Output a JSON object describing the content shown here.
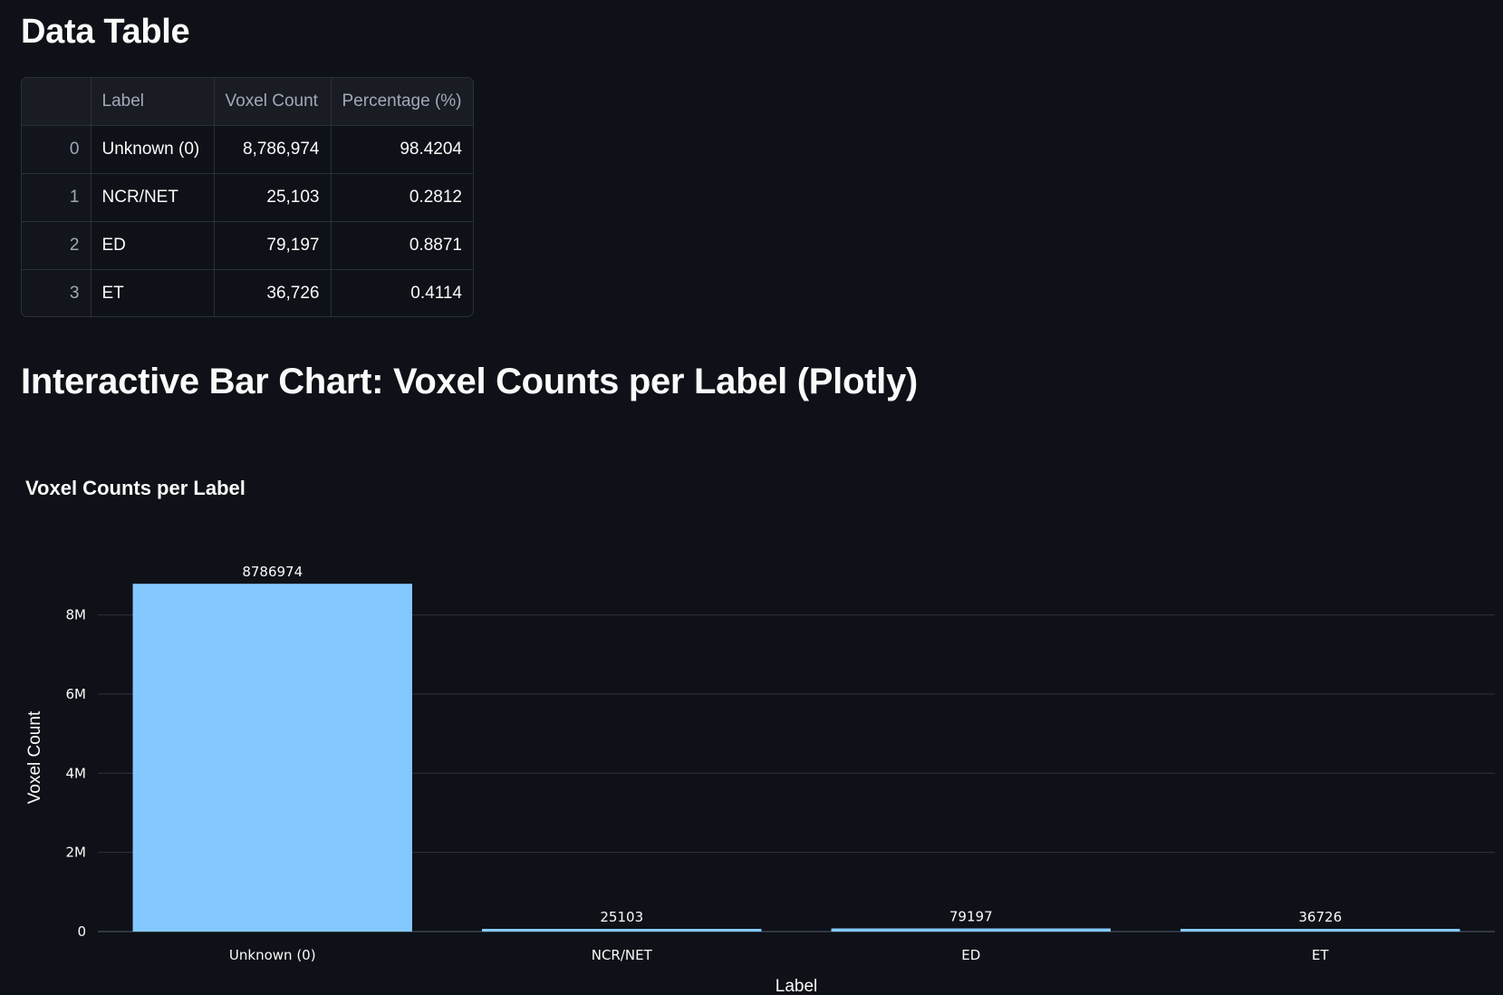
{
  "data_table": {
    "title": "Data Table",
    "columns": [
      "",
      "Label",
      "Voxel Count",
      "Percentage (%)"
    ],
    "rows": [
      {
        "index": "0",
        "label": "Unknown (0)",
        "voxel_count": "8,786,974",
        "percentage": "98.4204"
      },
      {
        "index": "1",
        "label": "NCR/NET",
        "voxel_count": "25,103",
        "percentage": "0.2812"
      },
      {
        "index": "2",
        "label": "ED",
        "voxel_count": "79,197",
        "percentage": "0.8871"
      },
      {
        "index": "3",
        "label": "ET",
        "voxel_count": "36,726",
        "percentage": "0.4114"
      }
    ]
  },
  "chart_section": {
    "title": "Interactive Bar Chart: Voxel Counts per Label (Plotly)"
  },
  "chart_data": {
    "type": "bar",
    "title": "Voxel Counts per Label",
    "xlabel": "Label",
    "ylabel": "Voxel Count",
    "categories": [
      "Unknown (0)",
      "NCR/NET",
      "ED",
      "ET"
    ],
    "values": [
      8786974,
      25103,
      79197,
      36726
    ],
    "data_labels": [
      "8786974",
      "25103",
      "79197",
      "36726"
    ],
    "ylim": [
      0,
      9249446
    ],
    "yticks": [
      0,
      2000000,
      4000000,
      6000000,
      8000000
    ],
    "ytick_labels": [
      "0",
      "2M",
      "4M",
      "6M",
      "8M"
    ],
    "bar_color": "#83c9ff",
    "grid": true,
    "legend": "none"
  }
}
